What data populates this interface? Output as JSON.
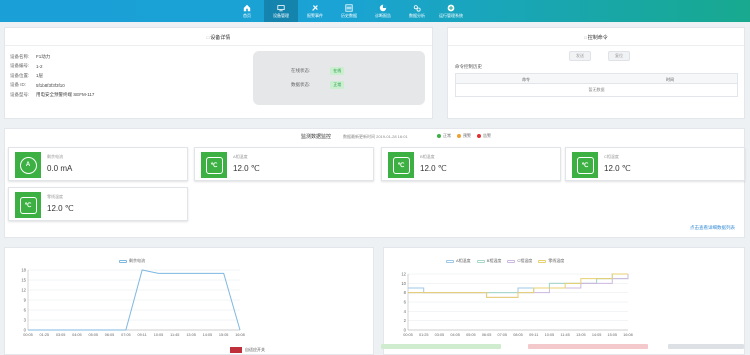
{
  "nav": {
    "items": [
      {
        "label": "首页",
        "icon": "home-icon"
      },
      {
        "label": "设备管理",
        "icon": "device-icon",
        "active": true
      },
      {
        "label": "报警事件",
        "icon": "alarm-icon"
      },
      {
        "label": "历史数据",
        "icon": "history-icon"
      },
      {
        "label": "诊断报告",
        "icon": "report-icon"
      },
      {
        "label": "数据分析",
        "icon": "analysis-icon"
      },
      {
        "label": "运行管理系统",
        "icon": "add-icon"
      }
    ]
  },
  "device": {
    "title": "设备详情",
    "fields": [
      {
        "k": "设备名称:",
        "v": "F1动力"
      },
      {
        "k": "设备编号:",
        "v": "1-2"
      },
      {
        "k": "设备位置:",
        "v": "1层"
      },
      {
        "k": "设备 ID:",
        "v": "5f1b8f3f3f3f10"
      },
      {
        "k": "设备型号:",
        "v": "用电安全预警终端 SEFM-117"
      }
    ],
    "status": [
      {
        "k": "在线状态:",
        "v": "在线"
      },
      {
        "k": "数据状态:",
        "v": "正常"
      }
    ]
  },
  "command": {
    "title": "控制命令",
    "btn1": "发送",
    "btn2": "复位",
    "list_label": "命令控制历史",
    "col1": "命令",
    "col2": "时间",
    "empty": "暂无数据"
  },
  "monitor": {
    "title": "监测数据监控",
    "update": "数据最新更新时间 2019-01-28 16:01",
    "legend": [
      {
        "label": "正常",
        "color": "#3cb043"
      },
      {
        "label": "预警",
        "color": "#f0a030"
      },
      {
        "label": "告警",
        "color": "#e03030"
      }
    ],
    "cards": [
      {
        "name": "剩余电流",
        "value": "0.0 mA",
        "icon": "A"
      },
      {
        "name": "A相温度",
        "value": "12.0 ℃",
        "icon": "℃"
      },
      {
        "name": "B相温度",
        "value": "12.0 ℃",
        "icon": "℃"
      },
      {
        "name": "C相温度",
        "value": "12.0 ℃",
        "icon": "℃"
      },
      {
        "name": "零线温度",
        "value": "12.0 ℃",
        "icon": "℃"
      }
    ],
    "more_link": "点击查看详细数据列表"
  },
  "chart_left": {
    "legend": "剩余电流",
    "color": "#7fb8e0",
    "bottom_label": "自适应开关"
  },
  "chart_right": {
    "legend": [
      "A相温度",
      "B相温度",
      "C相温度",
      "零线温度"
    ],
    "colors": [
      "#9ec9e8",
      "#a8d8c8",
      "#cdb8e0",
      "#e8d070"
    ]
  },
  "chart_data": [
    {
      "type": "line",
      "x": [
        "00:05",
        "01:25",
        "03:05",
        "04:05",
        "05:05",
        "06:05",
        "07:05",
        "09:11",
        "10:05",
        "11:45",
        "13:05",
        "14:05",
        "15:05",
        "16:08"
      ],
      "ylim": [
        0,
        18
      ],
      "yticks": [
        0,
        3,
        6,
        9,
        12,
        15,
        18
      ],
      "series": [
        {
          "name": "剩余电流",
          "values": [
            0,
            0,
            0,
            0,
            0,
            0,
            0,
            18,
            17,
            17,
            17,
            17,
            17,
            0
          ]
        }
      ]
    },
    {
      "type": "line",
      "x": [
        "00:05",
        "01:25",
        "03:05",
        "04:05",
        "05:05",
        "06:05",
        "07:05",
        "08:05",
        "09:11",
        "10:05",
        "11:45",
        "13:05",
        "14:05",
        "15:05",
        "16:08"
      ],
      "ylim": [
        0,
        12
      ],
      "yticks": [
        0,
        2,
        4,
        6,
        8,
        10,
        12
      ],
      "series": [
        {
          "name": "A相温度",
          "values": [
            9,
            8,
            8,
            8,
            8,
            8,
            8,
            9,
            9,
            10,
            10,
            10,
            11,
            12,
            12
          ]
        },
        {
          "name": "B相温度",
          "values": [
            8,
            8,
            8,
            8,
            8,
            8,
            8,
            8,
            9,
            10,
            10,
            10,
            11,
            11,
            12
          ]
        },
        {
          "name": "C相温度",
          "values": [
            8,
            8,
            8,
            8,
            8,
            7,
            7,
            8,
            8,
            9,
            9,
            10,
            10,
            11,
            12
          ]
        },
        {
          "name": "零线温度",
          "values": [
            8,
            8,
            8,
            8,
            8,
            7,
            7,
            8,
            9,
            9,
            10,
            11,
            11,
            12,
            12
          ]
        }
      ]
    }
  ]
}
